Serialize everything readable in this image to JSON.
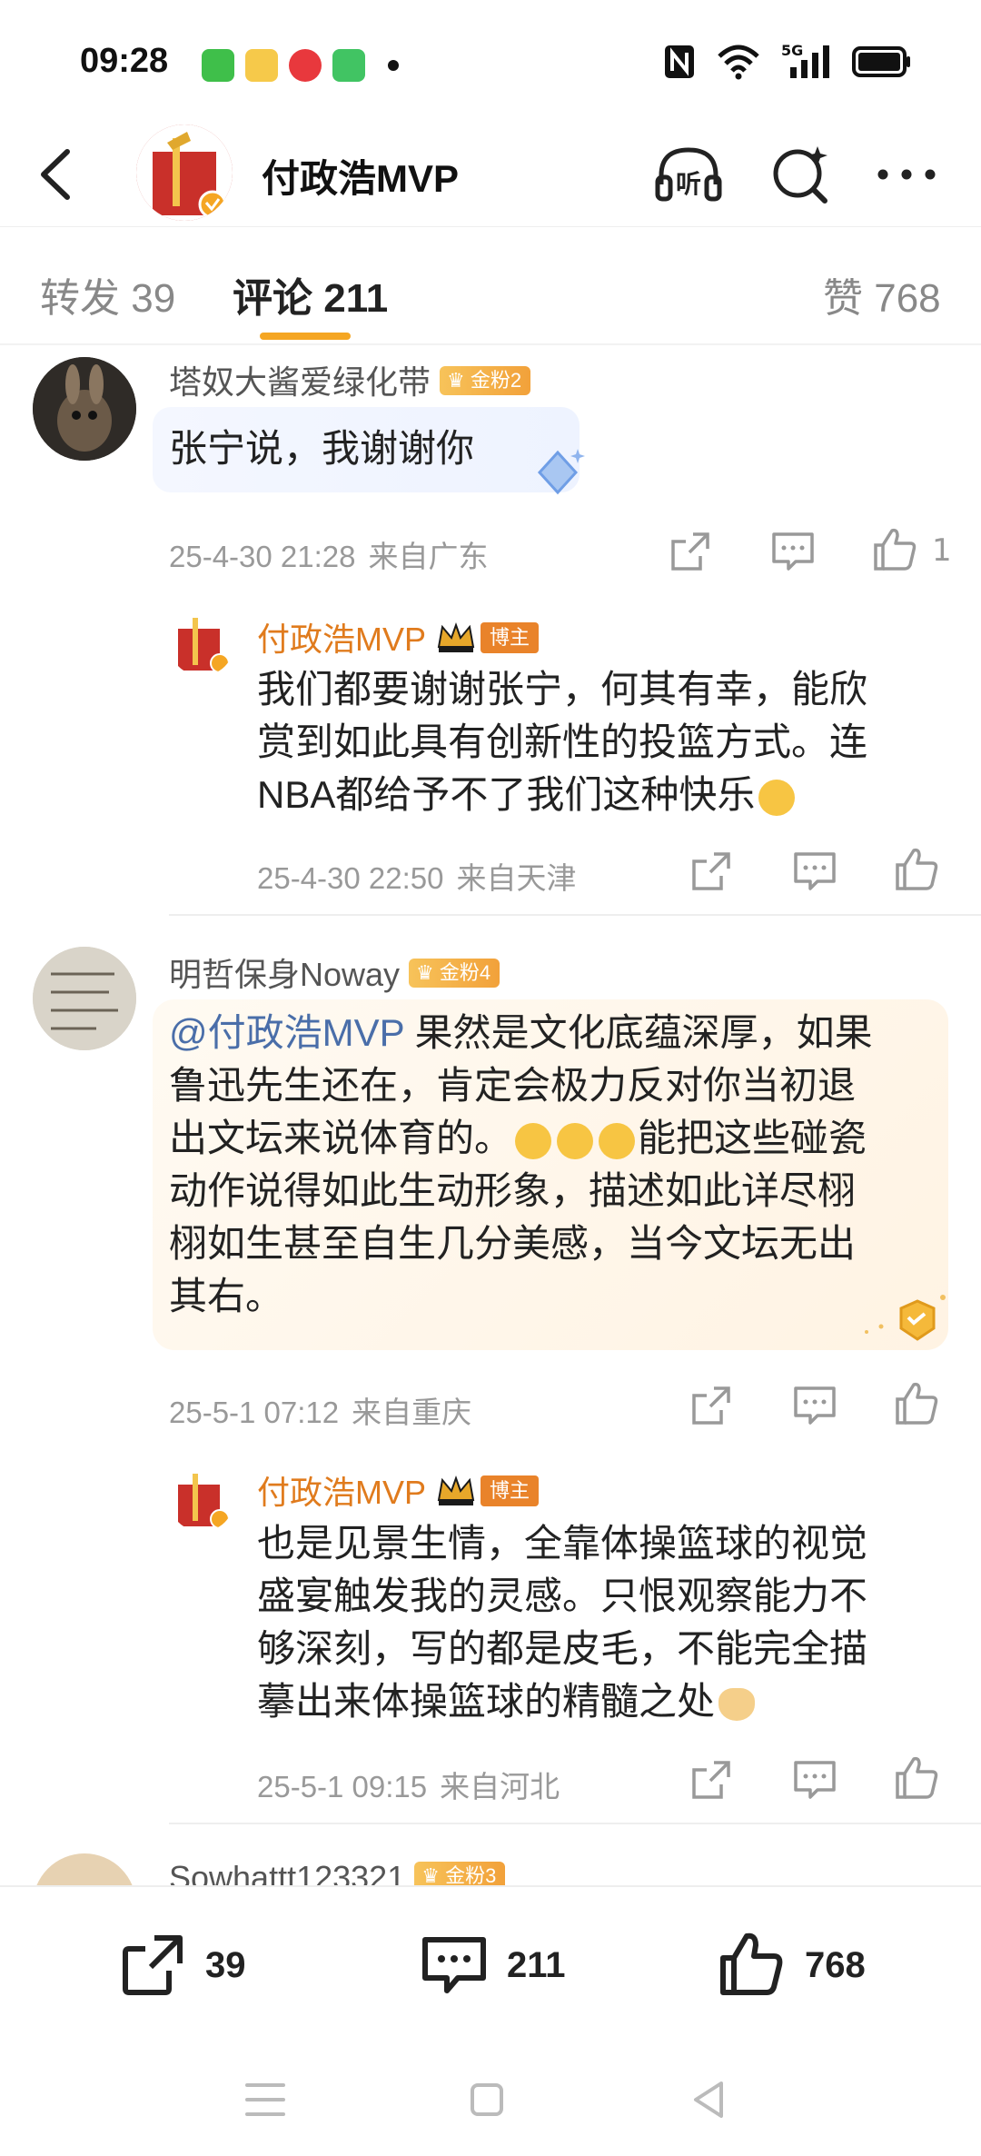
{
  "status": {
    "time": "09:28",
    "network": "5G"
  },
  "header": {
    "title": "付政浩MVP",
    "listen_label": "听"
  },
  "tabs": {
    "repost": "转发 39",
    "comments": "评论 211",
    "likes": "赞 768"
  },
  "comments": [
    {
      "user": "塔奴大酱爱绿化带",
      "badge": "金粉2",
      "text": "张宁说，我谢谢你",
      "time": "25-4-30 21:28",
      "location": "来自广东",
      "likes": "1",
      "reply": {
        "user": "付政浩MVP",
        "badge": "博主",
        "lines": [
          "我们都要谢谢张宁，何其有幸，能欣",
          "赏到如此具有创新性的投篮方式。连",
          "NBA都给予不了我们这种快乐"
        ],
        "time": "25-4-30 22:50",
        "location": "来自天津"
      }
    },
    {
      "user": "明哲保身Noway",
      "badge": "金粉4",
      "mention": "@付政浩MVP",
      "lines": [
        " 果然是文化底蕴深厚，如果",
        "鲁迅先生还在，肯定会极力反对你当初退",
        "出文坛来说体育的。",
        "能把这些碰瓷",
        "动作说得如此生动形象，描述如此详尽栩",
        "栩如生甚至自生几分美感，当今文坛无出",
        "其右。"
      ],
      "time": "25-5-1 07:12",
      "location": "来自重庆",
      "reply": {
        "user": "付政浩MVP",
        "badge": "博主",
        "lines": [
          "也是见景生情，全靠体操篮球的视觉",
          "盛宴触发我的灵感。只恨观察能力不",
          "够深刻，写的都是皮毛，不能完全描",
          "摹出来体操篮球的精髓之处"
        ],
        "time": "25-5-1 09:15",
        "location": "来自河北"
      }
    },
    {
      "user": "Sowhattt123321",
      "badge": "金粉3"
    }
  ],
  "bottom": {
    "reposts": "39",
    "comments": "211",
    "likes": "768"
  },
  "colors": {
    "accent": "#f5a623",
    "author": "#e07b1d",
    "mention": "#4a6ea9"
  }
}
